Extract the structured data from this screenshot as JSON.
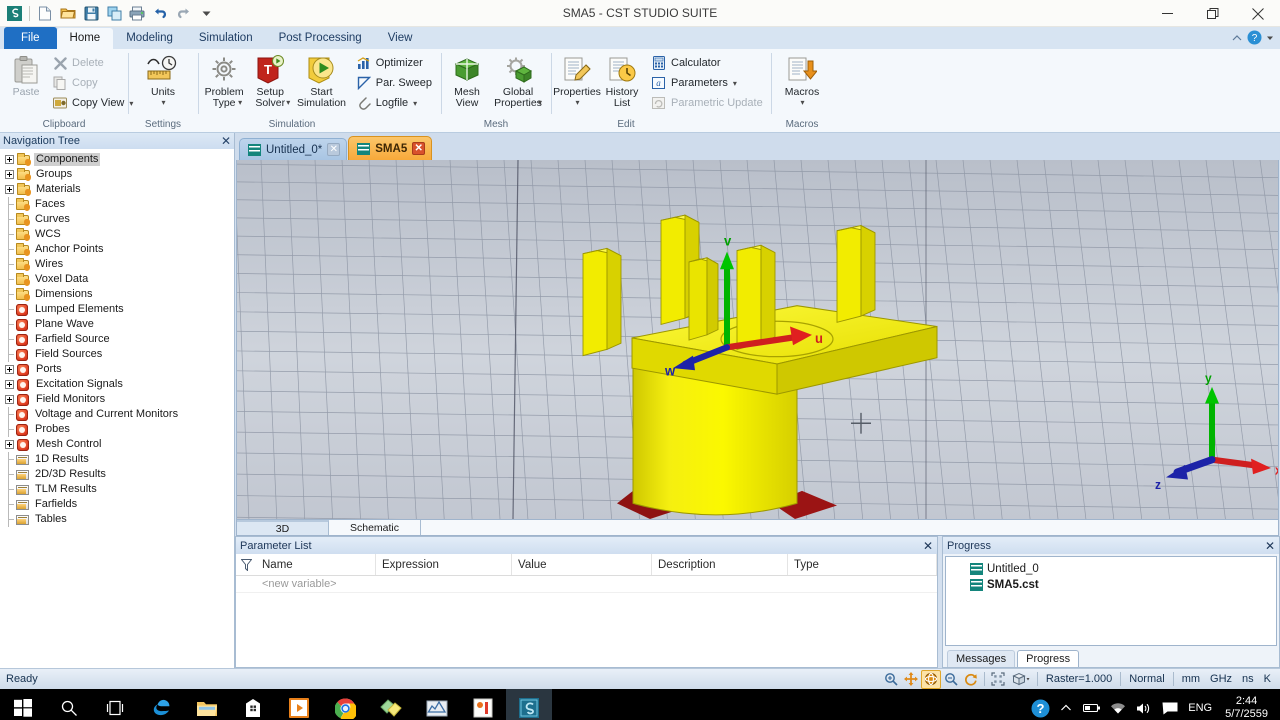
{
  "window": {
    "title": "SMA5 - CST STUDIO SUITE",
    "minimize": "–",
    "maximize": "❐",
    "close": "✕"
  },
  "quick_access": [
    {
      "name": "app-logo-icon",
      "label": "CST"
    },
    {
      "name": "new-file-icon",
      "label": "New"
    },
    {
      "name": "open-folder-icon",
      "label": "Open"
    },
    {
      "name": "save-icon",
      "label": "Save"
    },
    {
      "name": "copy-windows-icon",
      "label": "Copy"
    },
    {
      "name": "print-icon",
      "label": "Print"
    },
    {
      "name": "undo-icon",
      "label": "Undo"
    },
    {
      "name": "redo-icon",
      "label": "Redo"
    },
    {
      "name": "customize-qat-icon",
      "label": "Customize Quick Access Toolbar"
    }
  ],
  "ribbon": {
    "tabs": [
      {
        "label": "File",
        "active": false,
        "file": true
      },
      {
        "label": "Home",
        "active": true
      },
      {
        "label": "Modeling",
        "active": false
      },
      {
        "label": "Simulation",
        "active": false
      },
      {
        "label": "Post Processing",
        "active": false
      },
      {
        "label": "View",
        "active": false
      }
    ],
    "collapse_label": "⌃",
    "help_label": "?",
    "groups": [
      {
        "name": "clipboard",
        "label": "Clipboard",
        "big": [
          {
            "label": "Paste",
            "disabled": true
          }
        ],
        "small": [
          {
            "label": "Delete",
            "disabled": true,
            "icon": "delete-x-icon"
          },
          {
            "label": "Copy",
            "disabled": true,
            "icon": "copy-icon"
          },
          {
            "label": "Copy View",
            "disabled": false,
            "icon": "copy-view-icon",
            "caret": true
          }
        ]
      },
      {
        "name": "settings",
        "label": "Settings",
        "big": [
          {
            "label": "Units",
            "caret": true,
            "disabled": false
          }
        ],
        "small": []
      },
      {
        "name": "simulation",
        "label": "Simulation",
        "big": [
          {
            "label": "Problem\nType",
            "caret": true,
            "disabled": false
          },
          {
            "label": "Setup\nSolver",
            "caret": true,
            "disabled": false
          },
          {
            "label": "Start\nSimulation",
            "disabled": false
          }
        ],
        "small": [
          {
            "label": "Optimizer",
            "disabled": false,
            "icon": "optimizer-icon"
          },
          {
            "label": "Par. Sweep",
            "disabled": false,
            "icon": "par-sweep-icon"
          },
          {
            "label": "Logfile",
            "disabled": false,
            "icon": "logfile-icon",
            "caret": true
          }
        ]
      },
      {
        "name": "mesh",
        "label": "Mesh",
        "big": [
          {
            "label": "Mesh\nView",
            "disabled": false
          },
          {
            "label": "Global\nProperties",
            "caret": true,
            "disabled": false
          }
        ],
        "small": []
      },
      {
        "name": "edit",
        "label": "Edit",
        "big": [
          {
            "label": "Properties",
            "caret": true,
            "disabled": false
          },
          {
            "label": "History\nList",
            "disabled": false
          }
        ],
        "small": [
          {
            "label": "Calculator",
            "disabled": false,
            "icon": "calculator-icon"
          },
          {
            "label": "Parameters",
            "disabled": false,
            "icon": "parameters-icon",
            "caret": true
          },
          {
            "label": "Parametric Update",
            "disabled": true,
            "icon": "parametric-update-icon"
          }
        ]
      },
      {
        "name": "macros",
        "label": "Macros",
        "big": [
          {
            "label": "Macros",
            "caret": true,
            "disabled": false
          }
        ],
        "small": []
      }
    ]
  },
  "navigation_tree": {
    "title": "Navigation Tree",
    "close_label": "✕",
    "items": [
      {
        "label": "Components",
        "expandable": true,
        "icon": "folder-icon",
        "selected": true
      },
      {
        "label": "Groups",
        "expandable": true,
        "icon": "folder-icon"
      },
      {
        "label": "Materials",
        "expandable": true,
        "icon": "folder-icon"
      },
      {
        "label": "Faces",
        "expandable": false,
        "icon": "folder-icon"
      },
      {
        "label": "Curves",
        "expandable": false,
        "icon": "folder-icon"
      },
      {
        "label": "WCS",
        "expandable": false,
        "icon": "folder-icon"
      },
      {
        "label": "Anchor Points",
        "expandable": false,
        "icon": "folder-icon"
      },
      {
        "label": "Wires",
        "expandable": false,
        "icon": "folder-icon"
      },
      {
        "label": "Voxel Data",
        "expandable": false,
        "icon": "folder-icon"
      },
      {
        "label": "Dimensions",
        "expandable": false,
        "icon": "folder-icon"
      },
      {
        "label": "Lumped Elements",
        "expandable": false,
        "icon": "red-gear-icon"
      },
      {
        "label": "Plane Wave",
        "expandable": false,
        "icon": "red-gear-icon"
      },
      {
        "label": "Farfield Source",
        "expandable": false,
        "icon": "red-gear-icon"
      },
      {
        "label": "Field Sources",
        "expandable": false,
        "icon": "red-gear-icon"
      },
      {
        "label": "Ports",
        "expandable": true,
        "icon": "red-gear-icon"
      },
      {
        "label": "Excitation Signals",
        "expandable": true,
        "icon": "red-gear-icon"
      },
      {
        "label": "Field Monitors",
        "expandable": true,
        "icon": "red-gear-icon"
      },
      {
        "label": "Voltage and Current Monitors",
        "expandable": false,
        "icon": "red-gear-icon"
      },
      {
        "label": "Probes",
        "expandable": false,
        "icon": "red-gear-icon"
      },
      {
        "label": "Mesh Control",
        "expandable": true,
        "icon": "red-gear-icon"
      },
      {
        "label": "1D Results",
        "expandable": false,
        "icon": "results-icon"
      },
      {
        "label": "2D/3D Results",
        "expandable": false,
        "icon": "results-icon"
      },
      {
        "label": "TLM Results",
        "expandable": false,
        "icon": "results-icon"
      },
      {
        "label": "Farfields",
        "expandable": false,
        "icon": "results-icon"
      },
      {
        "label": "Tables",
        "expandable": false,
        "icon": "results-icon"
      }
    ]
  },
  "document_tabs": [
    {
      "label": "Untitled_0*",
      "active": false,
      "close": "✕"
    },
    {
      "label": "SMA5",
      "active": true,
      "close": "✕"
    }
  ],
  "viewport": {
    "axis_triad": {
      "x": "x",
      "y": "y",
      "z": "z"
    },
    "wcs": {
      "u": "u",
      "v": "v",
      "w": "w"
    },
    "model_color": "#f5f000",
    "port_color": "#9b1414",
    "background": "#c8cdd6",
    "view_tabs": [
      {
        "label": "3D",
        "active": true
      },
      {
        "label": "Schematic",
        "active": false
      }
    ]
  },
  "parameter_list": {
    "title": "Parameter List",
    "close_label": "✕",
    "filter_icon": "filter-funnel-icon",
    "columns": [
      "Name",
      "Expression",
      "Value",
      "Description",
      "Type"
    ],
    "rows": [
      [
        "<new variable>",
        "",
        "",
        "",
        ""
      ]
    ]
  },
  "progress_panel": {
    "title": "Progress",
    "close_label": "✕",
    "items": [
      {
        "label": "Untitled_0",
        "bold": false,
        "icon": "cst-file-icon"
      },
      {
        "label": "SMA5.cst",
        "bold": true,
        "icon": "cst-file-icon"
      }
    ],
    "tabs": [
      {
        "label": "Messages",
        "active": false
      },
      {
        "label": "Progress",
        "active": true
      }
    ]
  },
  "status_bar": {
    "message": "Ready",
    "tools": [
      {
        "name": "zoom-tool-icon",
        "active": false
      },
      {
        "name": "pan-tool-icon",
        "active": false
      },
      {
        "name": "rotate-tool-icon",
        "active": true
      },
      {
        "name": "zoom-out-tool-icon",
        "active": false
      },
      {
        "name": "reset-view-icon",
        "active": false
      },
      {
        "name": "fit-view-icon",
        "active": false
      },
      {
        "name": "view-box-icon",
        "active": false,
        "caret": true
      }
    ],
    "raster": "Raster=1.000",
    "mode": "Normal",
    "units": [
      "mm",
      "GHz",
      "ns",
      "K"
    ]
  },
  "taskbar": {
    "items": [
      {
        "name": "start-button-icon",
        "label": "Start"
      },
      {
        "name": "search-icon",
        "label": "Search"
      },
      {
        "name": "task-view-icon",
        "label": "Task View"
      },
      {
        "name": "edge-browser-icon",
        "label": "Microsoft Edge"
      },
      {
        "name": "file-explorer-icon",
        "label": "File Explorer"
      },
      {
        "name": "microsoft-store-icon",
        "label": "Store"
      },
      {
        "name": "media-player-icon",
        "label": "Movies & TV"
      },
      {
        "name": "chrome-browser-icon",
        "label": "Google Chrome"
      },
      {
        "name": "sticky-notes-icon",
        "label": "Sticky Notes"
      },
      {
        "name": "matlab-icon",
        "label": "MATLAB"
      },
      {
        "name": "office-app-icon",
        "label": "Office"
      },
      {
        "name": "cst-studio-icon",
        "label": "CST STUDIO SUITE",
        "active": true
      }
    ],
    "tray": [
      {
        "name": "help-circle-icon"
      },
      {
        "name": "show-hidden-icons-chevron"
      },
      {
        "name": "battery-icon"
      },
      {
        "name": "wifi-icon"
      },
      {
        "name": "volume-icon"
      },
      {
        "name": "action-center-icon"
      },
      {
        "name": "language-indicator",
        "label": "ENG"
      }
    ],
    "clock": {
      "time": "2:44",
      "date": "5/7/2559"
    }
  }
}
